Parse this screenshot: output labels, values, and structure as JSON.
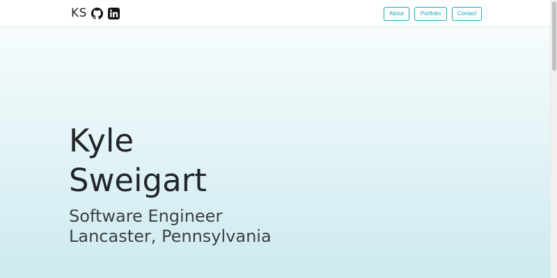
{
  "brand": {
    "initials": "KS",
    "github_icon": "github-icon",
    "linkedin_icon": "linkedin-icon"
  },
  "nav": {
    "items": [
      {
        "label": "About"
      },
      {
        "label": "Portfolio"
      },
      {
        "label": "Contact"
      }
    ]
  },
  "hero": {
    "name_line1": "Kyle",
    "name_line2": "Sweigart",
    "title": "Software Engineer",
    "location": "Lancaster, Pennsylvania"
  },
  "colors": {
    "accent": "#17a2b8",
    "text": "#212529",
    "hero_gradient_top": "#f7fcfc",
    "hero_gradient_bottom": "#cdeaef"
  }
}
